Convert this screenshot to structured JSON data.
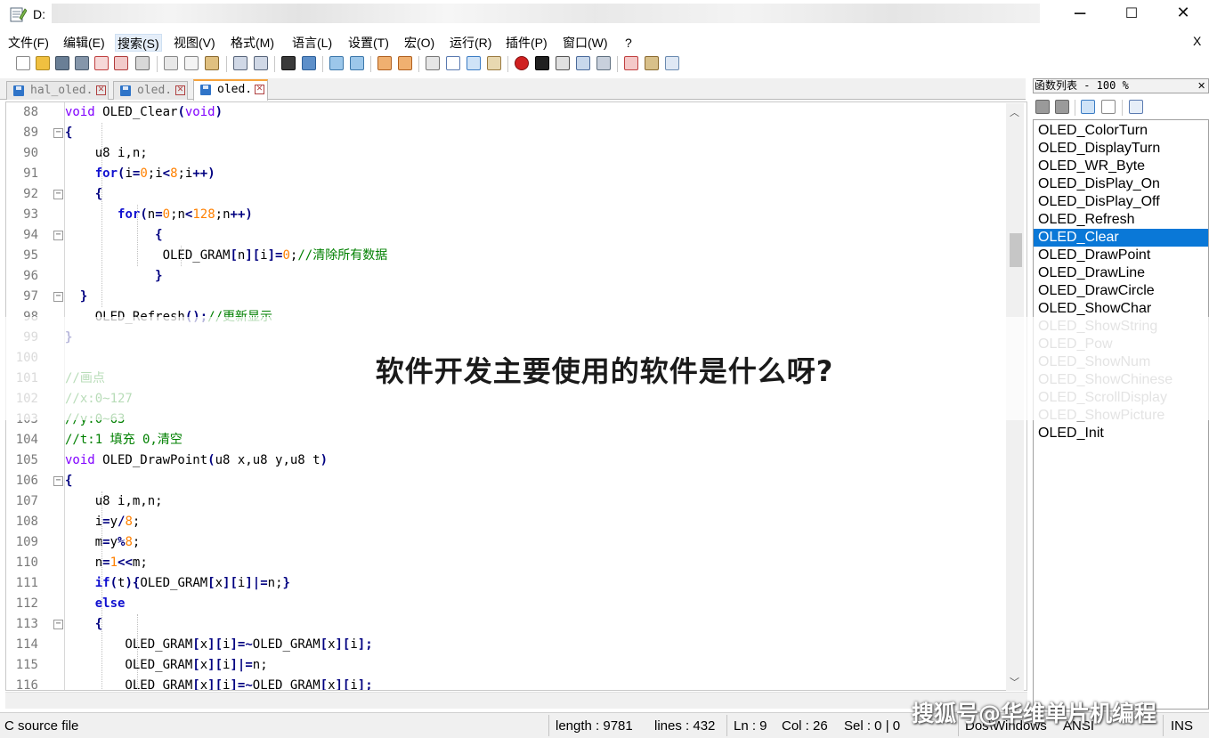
{
  "window": {
    "title": "D:",
    "minimize_glyph": "─",
    "maximize_glyph": "☐",
    "close_glyph": "✕"
  },
  "menu": {
    "items": [
      "文件(F)",
      "编辑(E)",
      "搜索(S)",
      "视图(V)",
      "格式(M)",
      "语言(L)",
      "设置(T)",
      "宏(O)",
      "运行(R)",
      "插件(P)",
      "窗口(W)",
      "?"
    ],
    "close_glyph": "X"
  },
  "tabs": [
    {
      "label": "hal_oled.",
      "close": "✕",
      "active": false
    },
    {
      "label": "oled.",
      "close": "✕",
      "active": false
    },
    {
      "label": "oled.",
      "close": "✕",
      "active": true
    }
  ],
  "editor": {
    "line_numbers": [
      "88",
      "89",
      "90",
      "91",
      "92",
      "93",
      "94",
      "95",
      "96",
      "97",
      "98",
      "99",
      "100",
      "101",
      "102",
      "103",
      "104",
      "105",
      "106",
      "107",
      "108",
      "109",
      "110",
      "111",
      "112",
      "113",
      "114",
      "115",
      "116"
    ],
    "fold_markers": [
      {
        "line": "89",
        "glyph": "−"
      },
      {
        "line": "92",
        "glyph": "−"
      },
      {
        "line": "94",
        "glyph": "−"
      },
      {
        "line": "97",
        "glyph": "−"
      },
      {
        "line": "106",
        "glyph": "−"
      },
      {
        "line": "113",
        "glyph": "−"
      }
    ],
    "lines": [
      [
        {
          "t": "void",
          "c": "kw-type"
        },
        {
          "t": " OLED_Clear"
        },
        {
          "t": "(",
          "c": "op"
        },
        {
          "t": "void",
          "c": "kw-type"
        },
        {
          "t": ")",
          "c": "op"
        }
      ],
      [
        {
          "t": "{",
          "c": "op"
        }
      ],
      [
        {
          "t": "    u8 i,n;"
        }
      ],
      [
        {
          "t": "    "
        },
        {
          "t": "for",
          "c": "kw-blue"
        },
        {
          "t": "(",
          "c": "op"
        },
        {
          "t": "i"
        },
        {
          "t": "=",
          "c": "op"
        },
        {
          "t": "0",
          "c": "num"
        },
        {
          "t": ";i"
        },
        {
          "t": "<",
          "c": "op"
        },
        {
          "t": "8",
          "c": "num"
        },
        {
          "t": ";i"
        },
        {
          "t": "++)",
          "c": "op"
        }
      ],
      [
        {
          "t": "    "
        },
        {
          "t": "{",
          "c": "op"
        }
      ],
      [
        {
          "t": "       "
        },
        {
          "t": "for",
          "c": "kw-blue"
        },
        {
          "t": "(",
          "c": "op"
        },
        {
          "t": "n"
        },
        {
          "t": "=",
          "c": "op"
        },
        {
          "t": "0",
          "c": "num"
        },
        {
          "t": ";n"
        },
        {
          "t": "<",
          "c": "op"
        },
        {
          "t": "128",
          "c": "num"
        },
        {
          "t": ";n"
        },
        {
          "t": "++)",
          "c": "op"
        }
      ],
      [
        {
          "t": "            "
        },
        {
          "t": "{",
          "c": "op"
        }
      ],
      [
        {
          "t": "             OLED_GRAM"
        },
        {
          "t": "[",
          "c": "op"
        },
        {
          "t": "n"
        },
        {
          "t": "][",
          "c": "op"
        },
        {
          "t": "i"
        },
        {
          "t": "]=",
          "c": "op"
        },
        {
          "t": "0",
          "c": "num"
        },
        {
          "t": ";"
        },
        {
          "t": "//清除所有数据",
          "c": "cmt"
        }
      ],
      [
        {
          "t": "            "
        },
        {
          "t": "}",
          "c": "op"
        }
      ],
      [
        {
          "t": "  "
        },
        {
          "t": "}",
          "c": "op"
        }
      ],
      [
        {
          "t": "    OLED_Refresh"
        },
        {
          "t": "();",
          "c": "op"
        },
        {
          "t": "//更新显示",
          "c": "cmt"
        }
      ],
      [
        {
          "t": "}",
          "c": "op"
        }
      ],
      [
        {
          "t": ""
        }
      ],
      [
        {
          "t": "//画点",
          "c": "cmt"
        }
      ],
      [
        {
          "t": "//x:0~127",
          "c": "cmt"
        }
      ],
      [
        {
          "t": "//y:0~63",
          "c": "cmt"
        }
      ],
      [
        {
          "t": "//t:1 填充 0,清空",
          "c": "cmt"
        }
      ],
      [
        {
          "t": "void",
          "c": "kw-type"
        },
        {
          "t": " OLED_DrawPoint"
        },
        {
          "t": "(",
          "c": "op"
        },
        {
          "t": "u8 x,u8 y,u8 t"
        },
        {
          "t": ")",
          "c": "op"
        }
      ],
      [
        {
          "t": "{",
          "c": "op"
        }
      ],
      [
        {
          "t": "    u8 i,m,n;"
        }
      ],
      [
        {
          "t": "    i"
        },
        {
          "t": "=",
          "c": "op"
        },
        {
          "t": "y"
        },
        {
          "t": "/",
          "c": "op"
        },
        {
          "t": "8",
          "c": "num"
        },
        {
          "t": ";"
        }
      ],
      [
        {
          "t": "    m"
        },
        {
          "t": "=",
          "c": "op"
        },
        {
          "t": "y"
        },
        {
          "t": "%",
          "c": "op"
        },
        {
          "t": "8",
          "c": "num"
        },
        {
          "t": ";"
        }
      ],
      [
        {
          "t": "    n"
        },
        {
          "t": "=",
          "c": "op"
        },
        {
          "t": "1",
          "c": "num"
        },
        {
          "t": "<<",
          "c": "op"
        },
        {
          "t": "m;"
        }
      ],
      [
        {
          "t": "    "
        },
        {
          "t": "if",
          "c": "kw-blue"
        },
        {
          "t": "(",
          "c": "op"
        },
        {
          "t": "t"
        },
        {
          "t": "){",
          "c": "op"
        },
        {
          "t": "OLED_GRAM"
        },
        {
          "t": "[",
          "c": "op"
        },
        {
          "t": "x"
        },
        {
          "t": "][",
          "c": "op"
        },
        {
          "t": "i"
        },
        {
          "t": "]|=",
          "c": "op"
        },
        {
          "t": "n;"
        },
        {
          "t": "}",
          "c": "op"
        }
      ],
      [
        {
          "t": "    "
        },
        {
          "t": "else",
          "c": "kw-blue"
        }
      ],
      [
        {
          "t": "    "
        },
        {
          "t": "{",
          "c": "op"
        }
      ],
      [
        {
          "t": "        OLED_GRAM"
        },
        {
          "t": "[",
          "c": "op"
        },
        {
          "t": "x"
        },
        {
          "t": "][",
          "c": "op"
        },
        {
          "t": "i"
        },
        {
          "t": "]=~",
          "c": "op"
        },
        {
          "t": "OLED_GRAM"
        },
        {
          "t": "[",
          "c": "op"
        },
        {
          "t": "x"
        },
        {
          "t": "][",
          "c": "op"
        },
        {
          "t": "i"
        },
        {
          "t": "];",
          "c": "op"
        }
      ],
      [
        {
          "t": "        OLED_GRAM"
        },
        {
          "t": "[",
          "c": "op"
        },
        {
          "t": "x"
        },
        {
          "t": "][",
          "c": "op"
        },
        {
          "t": "i"
        },
        {
          "t": "]|=",
          "c": "op"
        },
        {
          "t": "n;"
        }
      ],
      [
        {
          "t": "        OLED_GRAM"
        },
        {
          "t": "[",
          "c": "op"
        },
        {
          "t": "x"
        },
        {
          "t": "][",
          "c": "op"
        },
        {
          "t": "i"
        },
        {
          "t": "]=~",
          "c": "op"
        },
        {
          "t": "OLED_GRAM"
        },
        {
          "t": "[",
          "c": "op"
        },
        {
          "t": "x"
        },
        {
          "t": "][",
          "c": "op"
        },
        {
          "t": "i"
        },
        {
          "t": "];",
          "c": "op"
        }
      ]
    ]
  },
  "function_list": {
    "header": "函数列表 - 100 %",
    "close_glyph": "✕",
    "items": [
      {
        "name": "OLED_ColorTurn",
        "state": "normal"
      },
      {
        "name": "OLED_DisplayTurn",
        "state": "normal"
      },
      {
        "name": "OLED_WR_Byte",
        "state": "normal"
      },
      {
        "name": "OLED_DisPlay_On",
        "state": "normal"
      },
      {
        "name": "OLED_DisPlay_Off",
        "state": "normal"
      },
      {
        "name": "OLED_Refresh",
        "state": "normal"
      },
      {
        "name": "OLED_Clear",
        "state": "selected"
      },
      {
        "name": "OLED_DrawPoint",
        "state": "normal"
      },
      {
        "name": "OLED_DrawLine",
        "state": "normal"
      },
      {
        "name": "OLED_DrawCircle",
        "state": "normal"
      },
      {
        "name": "OLED_ShowChar",
        "state": "normal"
      },
      {
        "name": "OLED_ShowString",
        "state": "dim"
      },
      {
        "name": "OLED_Pow",
        "state": "dim"
      },
      {
        "name": "OLED_ShowNum",
        "state": "dim"
      },
      {
        "name": "OLED_ShowChinese",
        "state": "dim"
      },
      {
        "name": "OLED_ScrollDisplay",
        "state": "dim"
      },
      {
        "name": "OLED_ShowPicture",
        "state": "dim"
      },
      {
        "name": "OLED_Init",
        "state": "normal"
      }
    ]
  },
  "status": {
    "file_type": "C source file",
    "length": "length : 9781",
    "lines": "lines : 432",
    "ln": "Ln : 9",
    "col": "Col : 26",
    "sel": "Sel : 0 | 0",
    "eol": "Dos\\Windows",
    "encoding": "ANSI",
    "mode": "INS"
  },
  "overlay": {
    "banner_title": "软件开发主要使用的软件是什么呀?",
    "watermark": "搜狐号@华维单片机编程"
  },
  "colors": {
    "selection": "#0a78d7",
    "keyword": "#1010d0",
    "type": "#8000ff",
    "number": "#ff8000",
    "comment": "#008000",
    "tab_accent": "#f7a33b"
  }
}
